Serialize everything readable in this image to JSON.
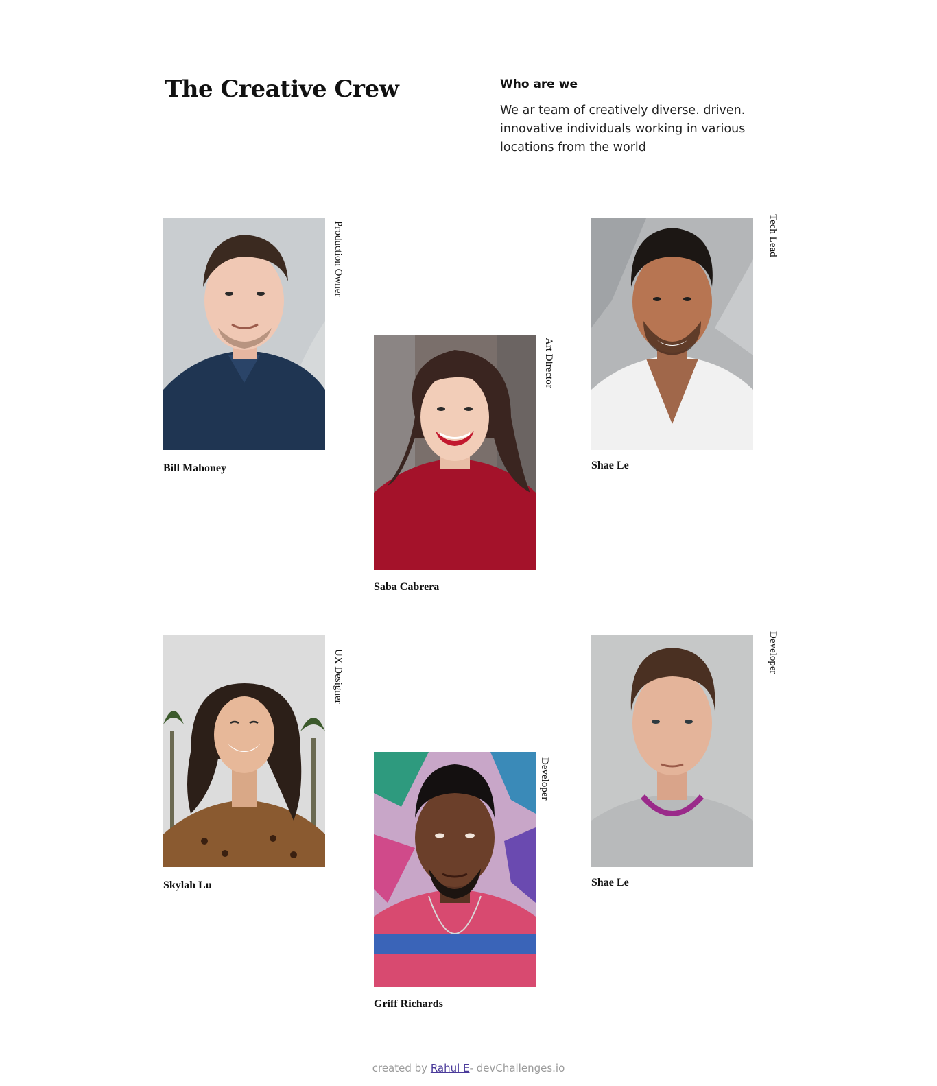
{
  "header": {
    "title": "The Creative Crew",
    "about_heading": "Who are we",
    "about_text": "We ar team of creatively diverse. driven. innovative individuals working in various locations from the world"
  },
  "members": [
    {
      "name": "Bill Mahoney",
      "role": "Production Owner",
      "photo_icon": "portrait-man-navy-polo"
    },
    {
      "name": "Saba Cabrera",
      "role": "Art Director",
      "photo_icon": "portrait-woman-red-sweater"
    },
    {
      "name": "Shae Le",
      "role": "Tech Lead",
      "photo_icon": "portrait-man-white-tshirt"
    },
    {
      "name": "Skylah Lu",
      "role": "UX Designer",
      "photo_icon": "portrait-woman-leopard-top"
    },
    {
      "name": "Griff Richards",
      "role": "Developer",
      "photo_icon": "portrait-man-striped-shirt"
    },
    {
      "name": "Shae Le",
      "role": "Developer",
      "photo_icon": "portrait-man-grey-sweater"
    }
  ],
  "footer": {
    "prefix": "created by ",
    "author": "Rahul E",
    "suffix": "- devChallenges.io"
  },
  "colors": {
    "background": "#ffffff",
    "text": "#111111",
    "footer_text": "#9a9a9a",
    "link": "#4a3a9a"
  }
}
